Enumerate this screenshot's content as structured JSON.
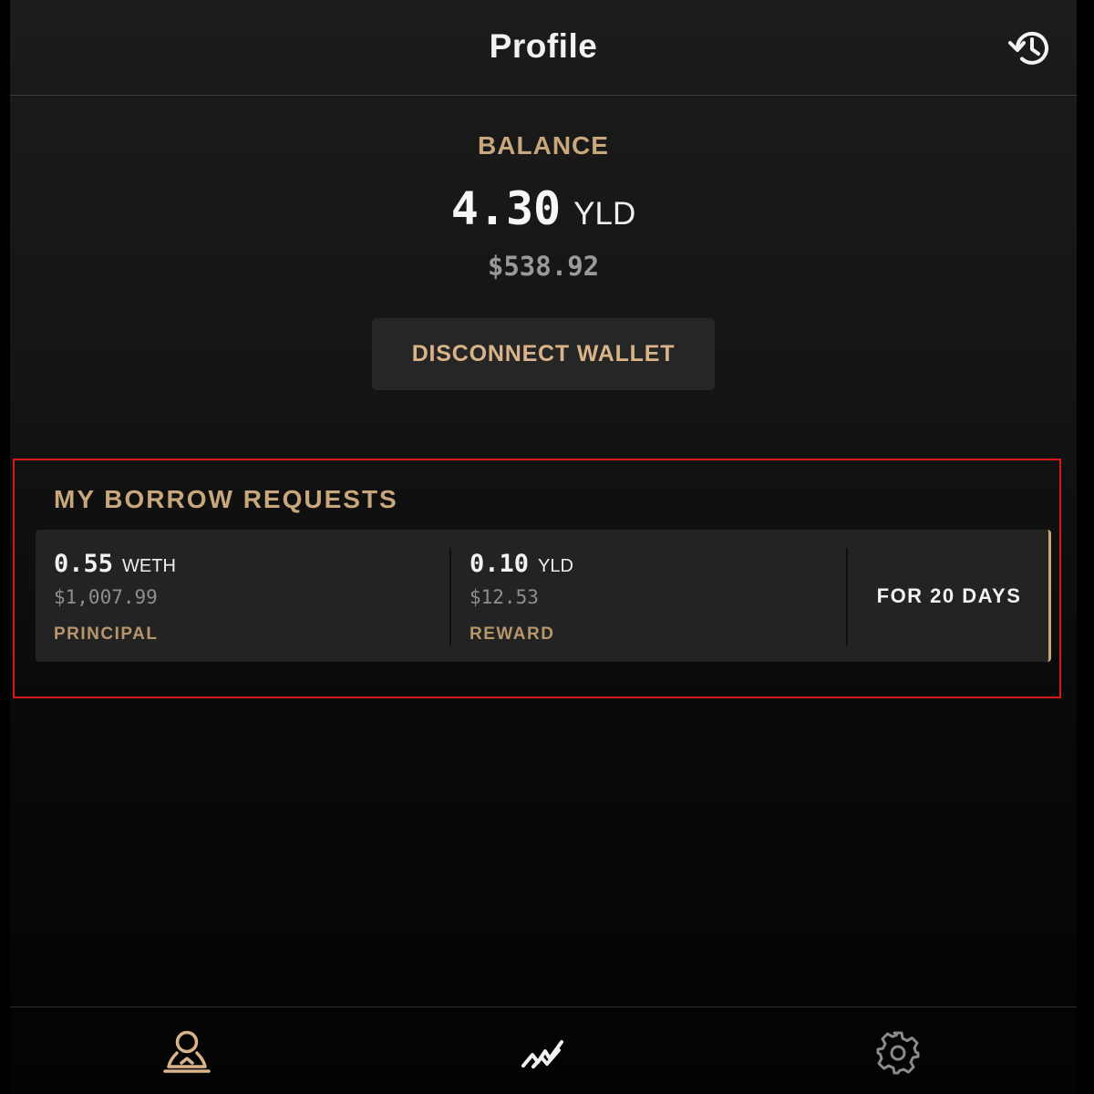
{
  "header": {
    "title": "Profile",
    "history_icon": "history-icon"
  },
  "balance": {
    "label": "BALANCE",
    "value": "4.30",
    "unit": "YLD",
    "usd": "$538.92"
  },
  "actions": {
    "disconnect_label": "DISCONNECT WALLET"
  },
  "borrow_requests": {
    "title": "MY BORROW REQUESTS",
    "items": [
      {
        "principal": {
          "amount": "0.55",
          "unit": "WETH",
          "usd": "$1,007.99",
          "label": "PRINCIPAL"
        },
        "reward": {
          "amount": "0.10",
          "unit": "YLD",
          "usd": "$12.53",
          "label": "REWARD"
        },
        "duration": "FOR 20 DAYS"
      }
    ]
  },
  "bottom_nav": {
    "items": [
      {
        "icon": "profile-icon",
        "active": true
      },
      {
        "icon": "trend-chart-icon",
        "active": false
      },
      {
        "icon": "gear-icon",
        "active": false
      }
    ]
  },
  "colors": {
    "accent": "#c8a77c",
    "highlight": "#d61a1a",
    "background": "#141414",
    "card": "#232323"
  }
}
